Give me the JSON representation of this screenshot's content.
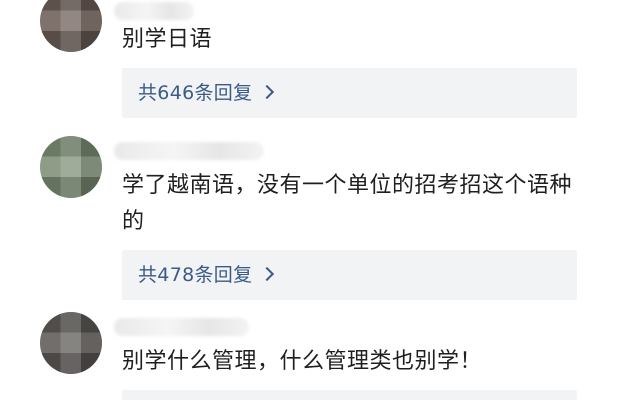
{
  "comments": [
    {
      "text": "别学日语",
      "reply_label": "共646条回复",
      "avatar_color": "#6d5f58"
    },
    {
      "text": "学了越南语，没有一个单位的招考招这个语种的",
      "reply_label": "共478条回复",
      "avatar_color": "#7e8f76"
    },
    {
      "text": "别学什么管理，什么管理类也别学！",
      "avatar_color": "#5e5a57"
    }
  ],
  "colors": {
    "reply_link": "#3b5a88",
    "reply_background": "#f2f3f5",
    "text": "#1f1f1f"
  }
}
